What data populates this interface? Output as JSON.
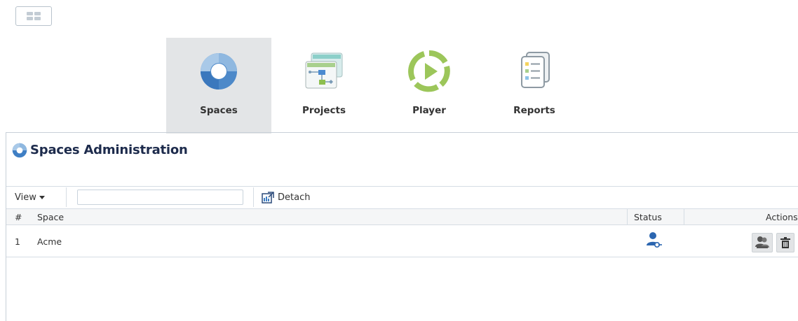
{
  "nav": {
    "items": [
      {
        "label": "Spaces",
        "icon": "spaces-icon",
        "active": true
      },
      {
        "label": "Projects",
        "icon": "projects-icon",
        "active": false
      },
      {
        "label": "Player",
        "icon": "player-icon",
        "active": false
      },
      {
        "label": "Reports",
        "icon": "reports-icon",
        "active": false
      }
    ]
  },
  "panel": {
    "title": "Spaces Administration"
  },
  "toolbar": {
    "view_label": "View",
    "filter_value": "",
    "detach_label": "Detach"
  },
  "table": {
    "columns": {
      "num": "#",
      "space": "Space",
      "status": "Status",
      "actions": "Actions"
    },
    "rows": [
      {
        "num": "1",
        "space": "Acme",
        "status_icon": "user-key-icon"
      }
    ]
  },
  "colors": {
    "accent": "#2c66b0",
    "player_green": "#9cc65a",
    "active_tab": "#e3e5e7"
  }
}
